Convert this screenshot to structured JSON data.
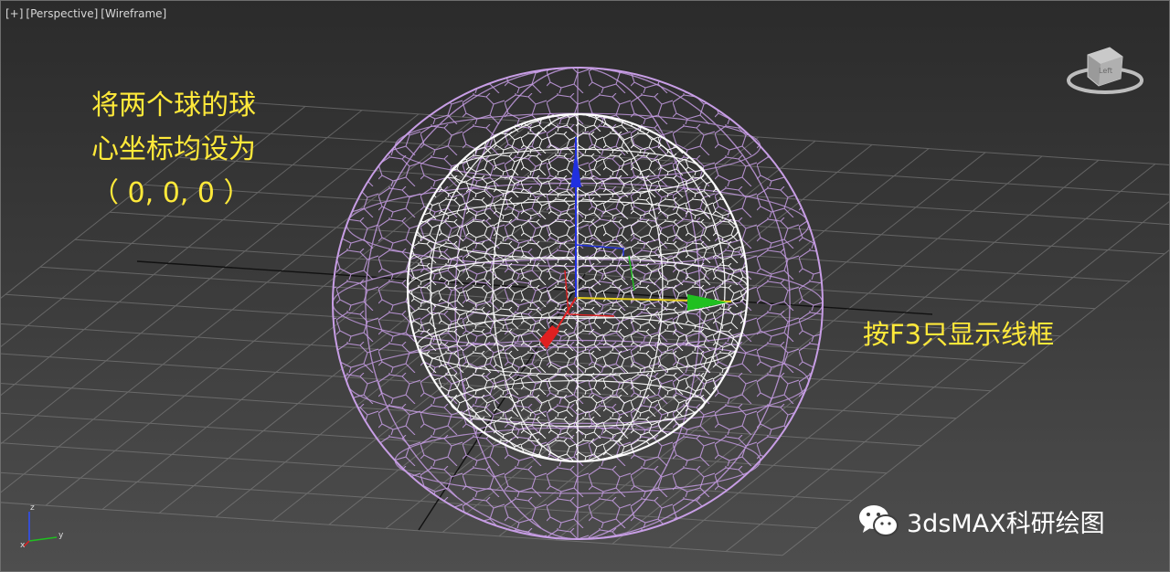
{
  "viewport": {
    "menu": [
      "[+]",
      "[Perspective]",
      "[Wireframe]"
    ]
  },
  "annotations": {
    "left_lines": [
      "将两个球的球",
      "心坐标均设为",
      "（ 0, 0, 0 ）"
    ],
    "right": "按F3只显示线框"
  },
  "viewcube": {
    "face_label": "Left"
  },
  "axis_tripod": {
    "z": "z",
    "x": "x",
    "y": "y"
  },
  "watermark": {
    "text": "3dsMAX科研绘图",
    "icon": "wechat-icon"
  },
  "colors": {
    "outer_sphere": "#c89ee6",
    "inner_sphere": "#ffffff",
    "grid": "#8a8a8a",
    "annotation": "#ffe93a",
    "gizmo_x": "#e02020",
    "gizmo_y": "#20c020",
    "gizmo_z": "#2030e0"
  }
}
